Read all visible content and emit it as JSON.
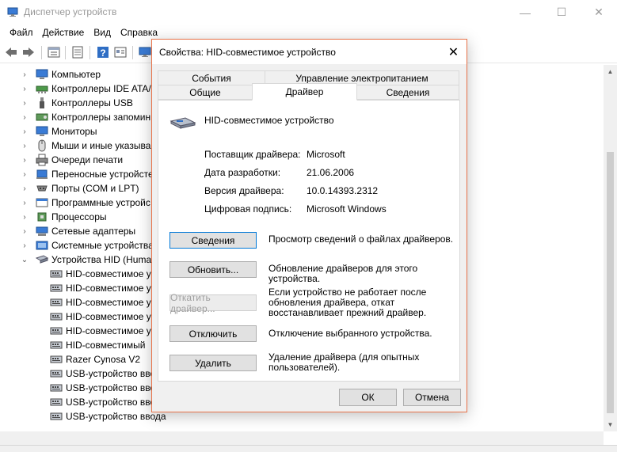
{
  "window": {
    "title": "Диспетчер устройств",
    "controls": {
      "minimize": "—",
      "maximize": "☐",
      "close": "✕"
    }
  },
  "menu": [
    "Файл",
    "Действие",
    "Вид",
    "Справка"
  ],
  "toolbar": {
    "icons": [
      "back-icon",
      "forward-icon",
      "properties-icon",
      "show-hide-icon",
      "help-icon",
      "properties2-icon",
      "scan-icon"
    ]
  },
  "tree": {
    "categories": [
      {
        "label": "Компьютер",
        "icon": "computer-icon"
      },
      {
        "label": "Контроллеры IDE ATA/",
        "icon": "ide-controller-icon"
      },
      {
        "label": "Контроллеры USB",
        "icon": "usb-icon"
      },
      {
        "label": "Контроллеры запомин",
        "icon": "storage-controller-icon"
      },
      {
        "label": "Мониторы",
        "icon": "monitor-icon"
      },
      {
        "label": "Мыши и иные указыва",
        "icon": "mouse-icon"
      },
      {
        "label": "Очереди печати",
        "icon": "printer-icon"
      },
      {
        "label": "Переносные устройсте",
        "icon": "portable-device-icon"
      },
      {
        "label": "Порты (COM и LPT)",
        "icon": "port-icon"
      },
      {
        "label": "Программные устройс",
        "icon": "software-device-icon"
      },
      {
        "label": "Процессоры",
        "icon": "processor-icon"
      },
      {
        "label": "Сетевые адаптеры",
        "icon": "network-adapter-icon"
      },
      {
        "label": "Системные устройства",
        "icon": "system-device-icon"
      },
      {
        "label": "Устройства HID (Huma",
        "icon": "hid-icon",
        "expanded": true
      }
    ],
    "hid_children": [
      "HID-совместимое у",
      "HID-совместимое у",
      "HID-совместимое у",
      "HID-совместимое у",
      "HID-совместимое у",
      "HID-совместимый",
      "Razer Cynosa V2",
      "USB-устройство ввод",
      "USB-устройство ввод",
      "USB-устройство ввод",
      "USB-устройство ввода"
    ]
  },
  "dialog": {
    "title": "Свойства: HID-совместимое устройство",
    "tabs_back": [
      "События",
      "Управление электропитанием"
    ],
    "tabs_front": [
      "Общие",
      "Драйвер",
      "Сведения"
    ],
    "active_tab": "Драйвер",
    "device_name": "HID-совместимое устройство",
    "properties": [
      {
        "label": "Поставщик драйвера:",
        "value": "Microsoft"
      },
      {
        "label": "Дата разработки:",
        "value": "21.06.2006"
      },
      {
        "label": "Версия драйвера:",
        "value": "10.0.14393.2312"
      },
      {
        "label": "Цифровая подпись:",
        "value": "Microsoft Windows"
      }
    ],
    "buttons": [
      {
        "label": "Сведения",
        "desc": "Просмотр сведений о файлах драйверов."
      },
      {
        "label": "Обновить...",
        "desc": "Обновление драйверов для этого устройства."
      },
      {
        "label": "Откатить драйвер...",
        "desc": "Если устройство не работает после обновления драйвера, откат восстанавливает прежний драйвер.",
        "disabled": true
      },
      {
        "label": "Отключить",
        "desc": "Отключение выбранного устройства."
      },
      {
        "label": "Удалить",
        "desc": "Удаление драйвера (для опытных пользователей)."
      }
    ],
    "ok": "ОК",
    "cancel": "Отмена"
  }
}
